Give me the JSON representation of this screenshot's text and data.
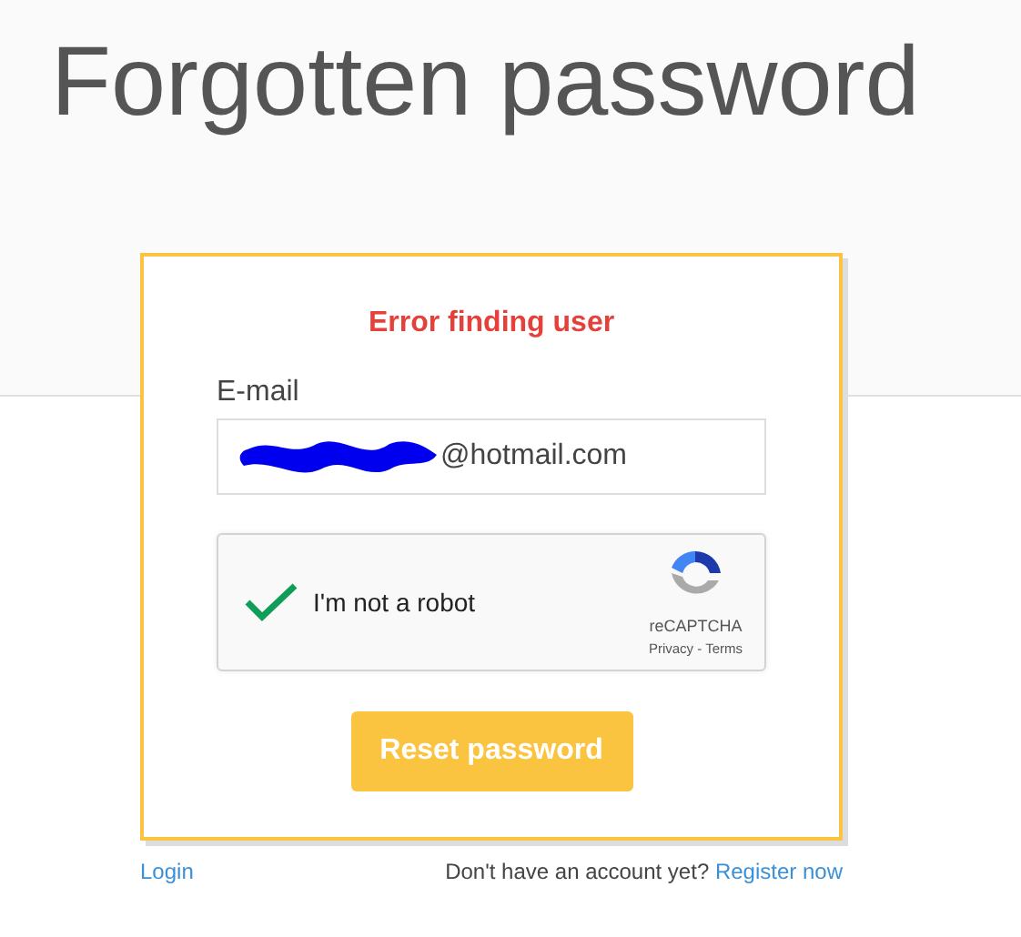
{
  "title": "Forgotten password",
  "error": "Error finding user",
  "email": {
    "label": "E-mail",
    "value": "@hotmail.com",
    "redacted": true
  },
  "captcha": {
    "label": "I'm not a robot",
    "checked": true,
    "brand": "reCAPTCHA",
    "privacy": "Privacy",
    "separator": " - ",
    "terms": "Terms"
  },
  "submit": "Reset password",
  "footer": {
    "login": "Login",
    "prompt": "Don't have an account yet?",
    "register": "Register now"
  }
}
